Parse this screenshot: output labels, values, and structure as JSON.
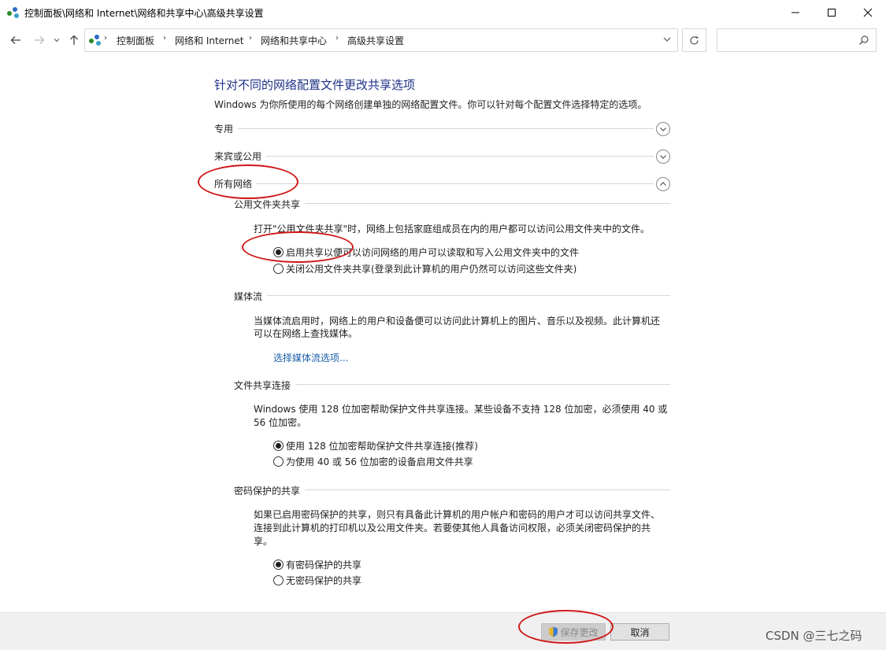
{
  "window": {
    "title": "控制面板\\网络和 Internet\\网络和共享中心\\高级共享设置",
    "minimize_glyph": "—",
    "maximize_glyph": "☐",
    "close_glyph": "✕"
  },
  "nav": {
    "back_glyph": "←",
    "forward_glyph": "→",
    "recent_glyph": "⌄",
    "up_glyph": "↑",
    "breadcrumbs": [
      "控制面板",
      "网络和 Internet",
      "网络和共享中心",
      "高级共享设置"
    ],
    "separator": "›",
    "refresh_glyph": "↻",
    "search_placeholder": ""
  },
  "page": {
    "heading": "针对不同的网络配置文件更改共享选项",
    "subheading": "Windows 为你所使用的每个网络创建单独的网络配置文件。你可以针对每个配置文件选择特定的选项。"
  },
  "profiles": [
    {
      "label": "专用",
      "expanded": false
    },
    {
      "label": "来宾或公用",
      "expanded": false
    },
    {
      "label": "所有网络",
      "expanded": true
    }
  ],
  "sections": {
    "public_folder": {
      "title": "公用文件夹共享",
      "description": "打开\"公用文件夹共享\"时，网络上包括家庭组成员在内的用户都可以访问公用文件夹中的文件。",
      "options": [
        {
          "label": "启用共享以便可以访问网络的用户可以读取和写入公用文件夹中的文件",
          "checked": true
        },
        {
          "label": "关闭公用文件夹共享(登录到此计算机的用户仍然可以访问这些文件夹)",
          "checked": false
        }
      ]
    },
    "media": {
      "title": "媒体流",
      "description_line1": "当媒体流启用时，网络上的用户和设备便可以访问此计算机上的图片、音乐以及视频。此计算机还",
      "description_line2": "可以在网络上查找媒体。",
      "link": "选择媒体流选项..."
    },
    "file_sharing": {
      "title": "文件共享连接",
      "description_line1": "Windows 使用 128 位加密帮助保护文件共享连接。某些设备不支持 128 位加密，必须使用 40 或",
      "description_line2": "56 位加密。",
      "options": [
        {
          "label": "使用 128 位加密帮助保护文件共享连接(推荐)",
          "checked": true
        },
        {
          "label": "为使用 40 或 56 位加密的设备启用文件共享",
          "checked": false
        }
      ]
    },
    "password": {
      "title": "密码保护的共享",
      "description_line1": "如果已启用密码保护的共享，则只有具备此计算机的用户帐户和密码的用户才可以访问共享文件、",
      "description_line2": "连接到此计算机的打印机以及公用文件夹。若要使其他人具备访问权限，必须关闭密码保护的共",
      "description_line3": "享。",
      "options": [
        {
          "label": "有密码保护的共享",
          "checked": true
        },
        {
          "label": "无密码保护的共享",
          "checked": false
        }
      ]
    }
  },
  "buttons": {
    "save": "保存更改",
    "cancel": "取消"
  },
  "watermark": "CSDN @三七之码",
  "colors": {
    "heading": "#1e3287",
    "link": "#1a5ea8",
    "annotation": "#d01818",
    "bottom_bar": "#f0f0f0"
  }
}
